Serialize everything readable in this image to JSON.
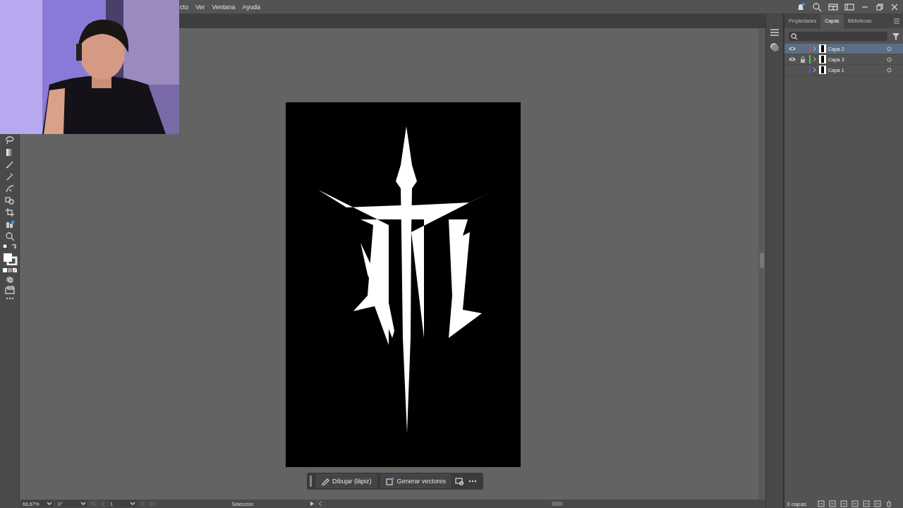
{
  "menu": [
    "cto",
    "Ver",
    "Ventana",
    "Ayuda"
  ],
  "panel": {
    "tabs": [
      {
        "label": "Propiedades",
        "selected": false
      },
      {
        "label": "Capas",
        "selected": true
      },
      {
        "label": "Bibliotecas",
        "selected": false
      }
    ],
    "layers": [
      {
        "name": "Capa 2",
        "visible": true,
        "locked": false,
        "selected": true,
        "color": "#d04a5a"
      },
      {
        "name": "Capa 3",
        "visible": true,
        "locked": true,
        "selected": false,
        "color": "#3fcf4a"
      },
      {
        "name": "Capa 1",
        "visible": false,
        "locked": false,
        "selected": false,
        "color": "#4a5ad8"
      }
    ],
    "count": "3 capas"
  },
  "context_bar": {
    "buttons": [
      {
        "label": "Dibujar (lápiz)",
        "kind": "pencil"
      },
      {
        "label": "Generar vectores",
        "kind": "generate"
      }
    ]
  },
  "status_bar": {
    "zoom": "66,67%",
    "rotation": "0°",
    "page": "1",
    "tool": "Selección"
  }
}
